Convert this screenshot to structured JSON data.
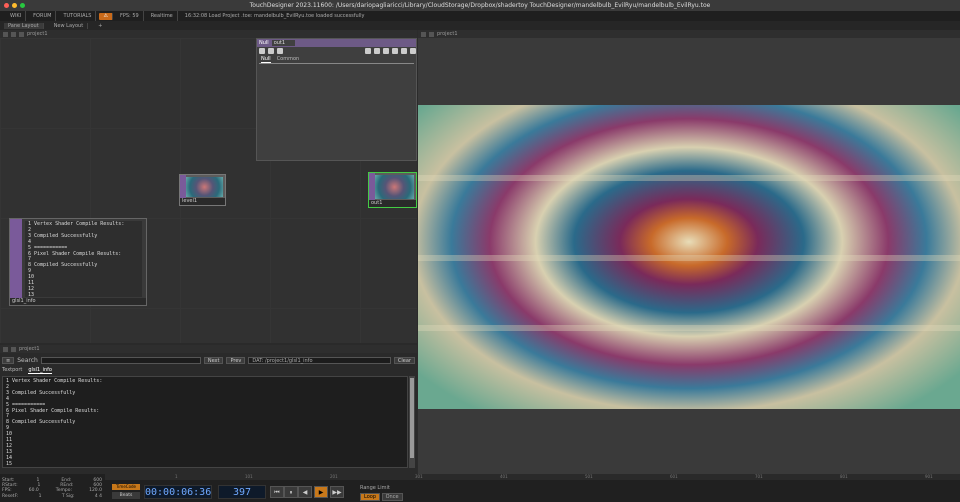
{
  "window": {
    "title": "TouchDesigner 2023.11600: /Users/dariopagliaricci/Library/CloudStorage/Dropbox/shadertoy TouchDesigner/mandelbulb_EvilRyu/mandelbulb_EvilRyu.toe"
  },
  "menubar": {
    "items": [
      "WIKI",
      "FORUM",
      "TUTORIALS"
    ],
    "warning": "⚠",
    "fps_label": "FPS:",
    "fps_value": "59",
    "realtime": "Realtime",
    "log": "16:32:08 Load Project .toe: mandelbulb_EvilRyu.toe loaded successfully"
  },
  "layoutbar": {
    "tabs": [
      "Pane Layout",
      "New Layout"
    ],
    "add": "+"
  },
  "network_pane": {
    "path": "project1"
  },
  "viewer_pane": {
    "path": "project1"
  },
  "textport_pane": {
    "path": "project1"
  },
  "nodes": {
    "level": "level1",
    "out": "out1",
    "info": "glsl1_info"
  },
  "param": {
    "type": "Null",
    "name": "out1",
    "tabs": [
      "Null",
      "Common"
    ]
  },
  "info_lines": [
    "1 Vertex Shader Compile Results:",
    "2",
    "3 Compiled Successfully",
    "4",
    "5 ===========",
    "6 Pixel Shader Compile Results:",
    "7",
    "8 Compiled Successfully",
    "9",
    "10",
    "11",
    "12",
    "13"
  ],
  "textport": {
    "search_label": "Search",
    "next": "Next",
    "prev": "Prev",
    "dat_path": "DAT: /project1/glsl1_info",
    "clear": "Clear",
    "tabs": [
      "Textport",
      "glsl1_info"
    ],
    "lines": [
      "1  Vertex Shader Compile Results:",
      "2",
      "3  Compiled Successfully",
      "4",
      "5  ===========",
      "6  Pixel Shader Compile Results:",
      "7",
      "8  Compiled Successfully",
      "9",
      "10",
      "11",
      "12",
      "13",
      "14",
      "15"
    ]
  },
  "timeline": {
    "ruler_ticks": [
      "1",
      "101",
      "201",
      "301",
      "401",
      "501",
      "601",
      "701",
      "801",
      "901"
    ],
    "stats": {
      "start_label": "Start:",
      "start": "1",
      "end_label": "End:",
      "end": "600",
      "rstart_label": "RStart:",
      "rstart": "1",
      "rend_label": "REnd:",
      "rend": "600",
      "fps_label": "FPS:",
      "fps": "60.0",
      "tempo_label": "Tempo:",
      "tempo": "120.0",
      "reset_label": "ResetF:",
      "reset": "1",
      "tsig_label": "T Sig:",
      "tsig": "4   4"
    },
    "timecode_btn": "TimeCode",
    "beats_btn": "Beats",
    "timecode": "00:00:06:36",
    "frame": "397",
    "range_label": "Range Limit",
    "range_loop": "Loop",
    "range_once": "Once",
    "transport": [
      "⏮",
      "⏸",
      "◀",
      "▶",
      "▶▶"
    ]
  }
}
